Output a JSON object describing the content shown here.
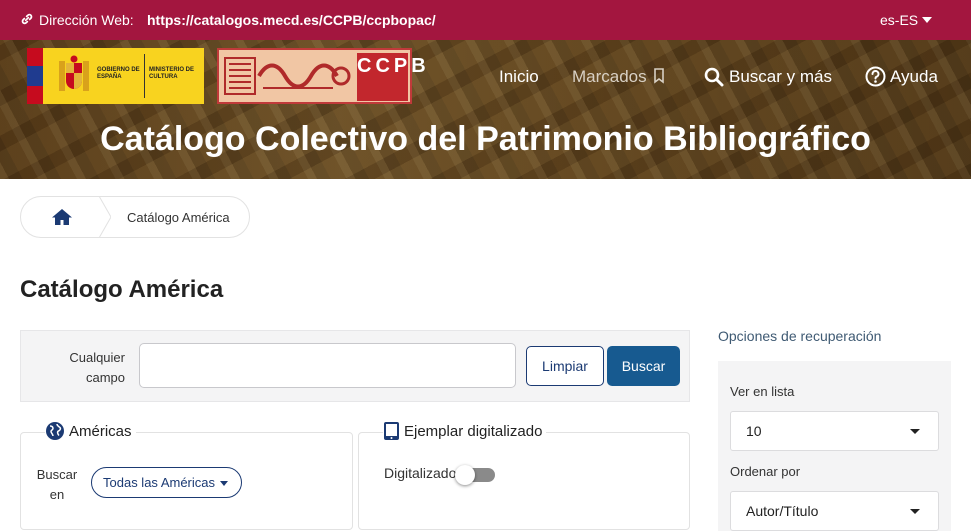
{
  "topbar": {
    "label": "Dirección Web:",
    "url": "https://catalogos.mecd.es/CCPB/ccpbopac/",
    "language": "es-ES"
  },
  "header": {
    "gov_logo": {
      "line1": "GOBIERNO DE ESPAÑA",
      "line2": "MINISTERIO DE CULTURA"
    },
    "ccpb_logo": {
      "letters": "CCPB"
    },
    "nav": {
      "inicio": "Inicio",
      "marcados": "Marcados",
      "buscar": "Buscar y más",
      "ayuda": "Ayuda"
    },
    "title": "Catálogo Colectivo del Patrimonio Bibliográfico"
  },
  "breadcrumb": {
    "current": "Catálogo América"
  },
  "page": {
    "title": "Catálogo América"
  },
  "search": {
    "field_label": "Cualquier campo",
    "input_value": "",
    "clear_label": "Limpiar",
    "search_label": "Buscar"
  },
  "filters": {
    "americas": {
      "heading": "Américas",
      "buscar_en": "Buscar en",
      "selected": "Todas las Américas"
    },
    "digital": {
      "heading": "Ejemplar digitalizado",
      "label": "Digitalizado",
      "enabled": false
    }
  },
  "options": {
    "title": "Opciones de recuperación",
    "list_label": "Ver en lista",
    "list_value": "10",
    "sort_label": "Ordenar por",
    "sort_value": "Autor/Título"
  },
  "colors": {
    "topbar": "#a3163f",
    "primary_button": "#175a90",
    "outline": "#1b3a73",
    "panel": "#f4f4f5"
  }
}
